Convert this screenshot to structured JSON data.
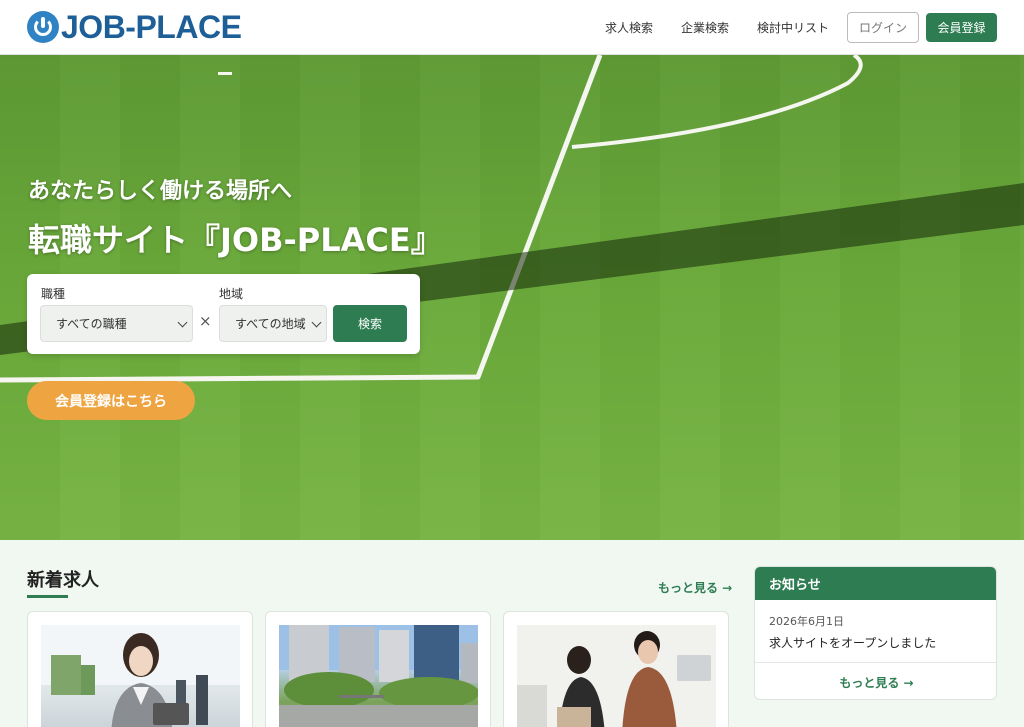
{
  "header": {
    "logo_text": "JOB-PLACE",
    "nav": [
      "求人検索",
      "企業検索",
      "検討中リスト"
    ],
    "login_label": "ログイン",
    "register_label": "会員登録"
  },
  "hero": {
    "subtitle": "あなたらしく働ける場所へ",
    "title": "転職サイト『JOB-PLACE』",
    "search": {
      "job_label": "職種",
      "job_value": "すべての職種",
      "area_label": "地域",
      "area_value": "すべての地域",
      "separator": "×",
      "button_label": "検索"
    },
    "cta_label": "会員登録はこちら"
  },
  "new_jobs": {
    "title": "新着求人",
    "more_label": "もっと見る →"
  },
  "notice": {
    "title": "お知らせ",
    "date": "2026年6月1日",
    "text": "求人サイトをオープンしました",
    "more_label": "もっと見る →"
  },
  "colors": {
    "brand_green": "#2e7d52",
    "accent_orange": "#eea441",
    "logo_blue": "#1f5f97"
  }
}
